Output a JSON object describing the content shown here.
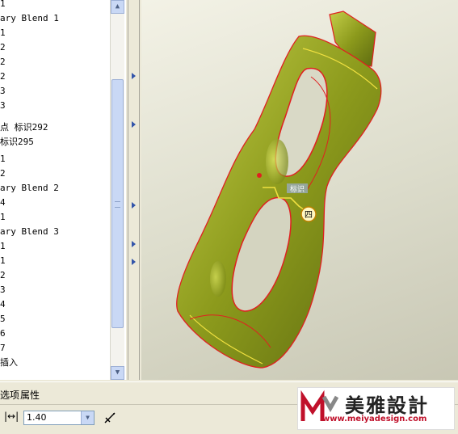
{
  "model_tree": {
    "items": [
      "1",
      "ary Blend 1",
      "1",
      "2",
      "2",
      "2",
      "3",
      "3",
      "点 标识292",
      "标识295",
      "1",
      "2",
      "ary Blend 2",
      "4",
      "1",
      "ary Blend 3",
      "1",
      "1",
      "2",
      "3",
      "4",
      "5",
      "6",
      "7",
      "插入"
    ]
  },
  "viewport": {
    "dimension_tag": "标识",
    "datum_label": "四"
  },
  "bottom_tabs": {
    "options_label": "选项",
    "properties_label": "属性"
  },
  "toolbar": {
    "thickness_value": "1.40"
  },
  "logo": {
    "cn_text": "美雅設計",
    "url": "www.meiyadesign.com"
  },
  "colors": {
    "surface_fill": "#9dab23",
    "edge_red": "#e02020",
    "edge_yellow": "#f0e040",
    "logo_red": "#c0102a"
  },
  "icons": {
    "dimension": "dimension-arrow-icon",
    "flip": "flip-direction-icon"
  }
}
